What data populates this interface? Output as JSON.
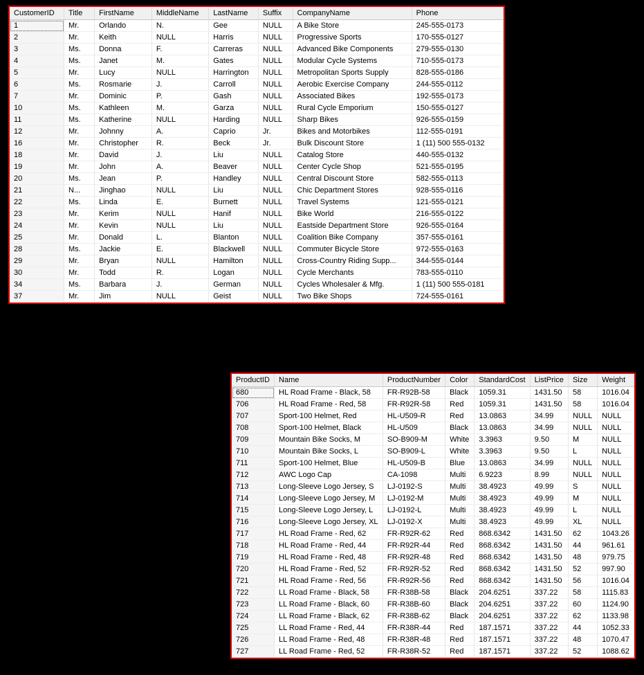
{
  "customers": {
    "headers": [
      "CustomerID",
      "Title",
      "FirstName",
      "MiddleName",
      "LastName",
      "Suffix",
      "CompanyName",
      "Phone"
    ],
    "rows": [
      [
        "1",
        "Mr.",
        "Orlando",
        "N.",
        "Gee",
        "NULL",
        "A Bike Store",
        "245-555-0173"
      ],
      [
        "2",
        "Mr.",
        "Keith",
        "NULL",
        "Harris",
        "NULL",
        "Progressive Sports",
        "170-555-0127"
      ],
      [
        "3",
        "Ms.",
        "Donna",
        "F.",
        "Carreras",
        "NULL",
        "Advanced Bike Components",
        "279-555-0130"
      ],
      [
        "4",
        "Ms.",
        "Janet",
        "M.",
        "Gates",
        "NULL",
        "Modular Cycle Systems",
        "710-555-0173"
      ],
      [
        "5",
        "Mr.",
        "Lucy",
        "NULL",
        "Harrington",
        "NULL",
        "Metropolitan Sports Supply",
        "828-555-0186"
      ],
      [
        "6",
        "Ms.",
        "Rosmarie",
        "J.",
        "Carroll",
        "NULL",
        "Aerobic Exercise Company",
        "244-555-0112"
      ],
      [
        "7",
        "Mr.",
        "Dominic",
        "P.",
        "Gash",
        "NULL",
        "Associated Bikes",
        "192-555-0173"
      ],
      [
        "10",
        "Ms.",
        "Kathleen",
        "M.",
        "Garza",
        "NULL",
        "Rural Cycle Emporium",
        "150-555-0127"
      ],
      [
        "11",
        "Ms.",
        "Katherine",
        "NULL",
        "Harding",
        "NULL",
        "Sharp Bikes",
        "926-555-0159"
      ],
      [
        "12",
        "Mr.",
        "Johnny",
        "A.",
        "Caprio",
        "Jr.",
        "Bikes and Motorbikes",
        "112-555-0191"
      ],
      [
        "16",
        "Mr.",
        "Christopher",
        "R.",
        "Beck",
        "Jr.",
        "Bulk Discount Store",
        "1 (11) 500 555-0132"
      ],
      [
        "18",
        "Mr.",
        "David",
        "J.",
        "Liu",
        "NULL",
        "Catalog Store",
        "440-555-0132"
      ],
      [
        "19",
        "Mr.",
        "John",
        "A.",
        "Beaver",
        "NULL",
        "Center Cycle Shop",
        "521-555-0195"
      ],
      [
        "20",
        "Ms.",
        "Jean",
        "P.",
        "Handley",
        "NULL",
        "Central Discount Store",
        "582-555-0113"
      ],
      [
        "21",
        "N...",
        "Jinghao",
        "NULL",
        "Liu",
        "NULL",
        "Chic Department Stores",
        "928-555-0116"
      ],
      [
        "22",
        "Ms.",
        "Linda",
        "E.",
        "Burnett",
        "NULL",
        "Travel Systems",
        "121-555-0121"
      ],
      [
        "23",
        "Mr.",
        "Kerim",
        "NULL",
        "Hanif",
        "NULL",
        "Bike World",
        "216-555-0122"
      ],
      [
        "24",
        "Mr.",
        "Kevin",
        "NULL",
        "Liu",
        "NULL",
        "Eastside Department Store",
        "926-555-0164"
      ],
      [
        "25",
        "Mr.",
        "Donald",
        "L.",
        "Blanton",
        "NULL",
        "Coalition Bike Company",
        "357-555-0161"
      ],
      [
        "28",
        "Ms.",
        "Jackie",
        "E.",
        "Blackwell",
        "NULL",
        "Commuter Bicycle Store",
        "972-555-0163"
      ],
      [
        "29",
        "Mr.",
        "Bryan",
        "NULL",
        "Hamilton",
        "NULL",
        "Cross-Country Riding Supp...",
        "344-555-0144"
      ],
      [
        "30",
        "Mr.",
        "Todd",
        "R.",
        "Logan",
        "NULL",
        "Cycle Merchants",
        "783-555-0110"
      ],
      [
        "34",
        "Ms.",
        "Barbara",
        "J.",
        "German",
        "NULL",
        "Cycles Wholesaler & Mfg.",
        "1 (11) 500 555-0181"
      ],
      [
        "37",
        "Mr.",
        "Jim",
        "NULL",
        "Geist",
        "NULL",
        "Two Bike Shops",
        "724-555-0161"
      ]
    ]
  },
  "products": {
    "headers": [
      "ProductID",
      "Name",
      "ProductNumber",
      "Color",
      "StandardCost",
      "ListPrice",
      "Size",
      "Weight"
    ],
    "rows": [
      [
        "680",
        "HL Road Frame - Black, 58",
        "FR-R92B-58",
        "Black",
        "1059.31",
        "1431.50",
        "58",
        "1016.04"
      ],
      [
        "706",
        "HL Road Frame - Red, 58",
        "FR-R92R-58",
        "Red",
        "1059.31",
        "1431.50",
        "58",
        "1016.04"
      ],
      [
        "707",
        "Sport-100 Helmet, Red",
        "HL-U509-R",
        "Red",
        "13.0863",
        "34.99",
        "NULL",
        "NULL"
      ],
      [
        "708",
        "Sport-100 Helmet, Black",
        "HL-U509",
        "Black",
        "13.0863",
        "34.99",
        "NULL",
        "NULL"
      ],
      [
        "709",
        "Mountain Bike Socks, M",
        "SO-B909-M",
        "White",
        "3.3963",
        "9.50",
        "M",
        "NULL"
      ],
      [
        "710",
        "Mountain Bike Socks, L",
        "SO-B909-L",
        "White",
        "3.3963",
        "9.50",
        "L",
        "NULL"
      ],
      [
        "711",
        "Sport-100 Helmet, Blue",
        "HL-U509-B",
        "Blue",
        "13.0863",
        "34.99",
        "NULL",
        "NULL"
      ],
      [
        "712",
        "AWC Logo Cap",
        "CA-1098",
        "Multi",
        "6.9223",
        "8.99",
        "NULL",
        "NULL"
      ],
      [
        "713",
        "Long-Sleeve Logo Jersey, S",
        "LJ-0192-S",
        "Multi",
        "38.4923",
        "49.99",
        "S",
        "NULL"
      ],
      [
        "714",
        "Long-Sleeve Logo Jersey, M",
        "LJ-0192-M",
        "Multi",
        "38.4923",
        "49.99",
        "M",
        "NULL"
      ],
      [
        "715",
        "Long-Sleeve Logo Jersey, L",
        "LJ-0192-L",
        "Multi",
        "38.4923",
        "49.99",
        "L",
        "NULL"
      ],
      [
        "716",
        "Long-Sleeve Logo Jersey, XL",
        "LJ-0192-X",
        "Multi",
        "38.4923",
        "49.99",
        "XL",
        "NULL"
      ],
      [
        "717",
        "HL Road Frame - Red, 62",
        "FR-R92R-62",
        "Red",
        "868.6342",
        "1431.50",
        "62",
        "1043.26"
      ],
      [
        "718",
        "HL Road Frame - Red, 44",
        "FR-R92R-44",
        "Red",
        "868.6342",
        "1431.50",
        "44",
        "961.61"
      ],
      [
        "719",
        "HL Road Frame - Red, 48",
        "FR-R92R-48",
        "Red",
        "868.6342",
        "1431.50",
        "48",
        "979.75"
      ],
      [
        "720",
        "HL Road Frame - Red, 52",
        "FR-R92R-52",
        "Red",
        "868.6342",
        "1431.50",
        "52",
        "997.90"
      ],
      [
        "721",
        "HL Road Frame - Red, 56",
        "FR-R92R-56",
        "Red",
        "868.6342",
        "1431.50",
        "56",
        "1016.04"
      ],
      [
        "722",
        "LL Road Frame - Black, 58",
        "FR-R38B-58",
        "Black",
        "204.6251",
        "337.22",
        "58",
        "1115.83"
      ],
      [
        "723",
        "LL Road Frame - Black, 60",
        "FR-R38B-60",
        "Black",
        "204.6251",
        "337.22",
        "60",
        "1124.90"
      ],
      [
        "724",
        "LL Road Frame - Black, 62",
        "FR-R38B-62",
        "Black",
        "204.6251",
        "337.22",
        "62",
        "1133.98"
      ],
      [
        "725",
        "LL Road Frame - Red, 44",
        "FR-R38R-44",
        "Red",
        "187.1571",
        "337.22",
        "44",
        "1052.33"
      ],
      [
        "726",
        "LL Road Frame - Red, 48",
        "FR-R38R-48",
        "Red",
        "187.1571",
        "337.22",
        "48",
        "1070.47"
      ],
      [
        "727",
        "LL Road Frame - Red, 52",
        "FR-R38R-52",
        "Red",
        "187.1571",
        "337.22",
        "52",
        "1088.62"
      ]
    ]
  }
}
